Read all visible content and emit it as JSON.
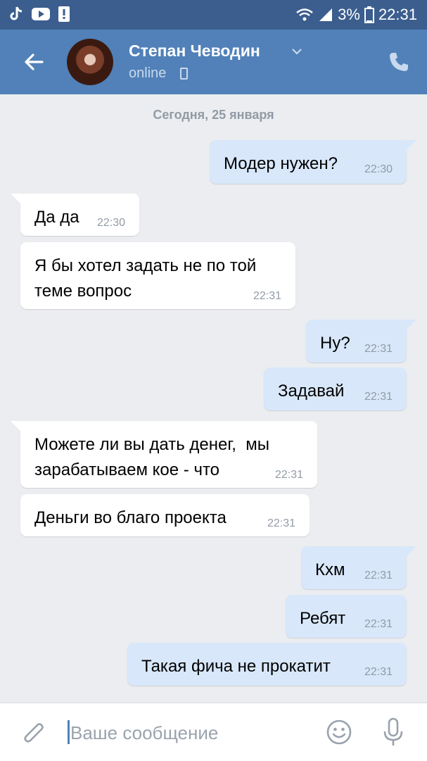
{
  "statusbar": {
    "battery_percent": "3%",
    "time": "22:31",
    "icons": [
      "tiktok-icon",
      "youtube-icon",
      "notification-icon",
      "wifi-icon",
      "signal-icon",
      "battery-icon"
    ]
  },
  "header": {
    "contact_name": "Степан Чеводин",
    "status": "online",
    "icons": [
      "back-arrow-icon",
      "avatar",
      "chevron-down-icon",
      "phone-icon",
      "mobile-status-icon"
    ]
  },
  "chat": {
    "date_divider": "Сегодня, 25 января",
    "messages": [
      {
        "dir": "out",
        "text": "Модер нужен?",
        "time": "22:30"
      },
      {
        "dir": "in",
        "text": "Да да",
        "time": "22:30"
      },
      {
        "dir": "in",
        "text": "Я бы хотел задать не по той\nтеме вопрос",
        "time": "22:31"
      },
      {
        "dir": "out",
        "text": "Ну?",
        "time": "22:31"
      },
      {
        "dir": "out",
        "text": "Задавай",
        "time": "22:31"
      },
      {
        "dir": "in",
        "text": "Можете ли вы дать денег,  мы\nзарабатываем кое - что",
        "time": "22:31"
      },
      {
        "dir": "in",
        "text": "Деньги во благо проекта",
        "time": "22:31"
      },
      {
        "dir": "out",
        "text": "Кхм",
        "time": "22:31"
      },
      {
        "dir": "out",
        "text": "Ребят",
        "time": "22:31"
      },
      {
        "dir": "out",
        "text": "Такая фича не прокатит",
        "time": "22:31"
      }
    ]
  },
  "composer": {
    "placeholder": "Ваше сообщение",
    "icons": [
      "attach-icon",
      "emoji-icon",
      "microphone-icon"
    ]
  },
  "colors": {
    "header_bg": "#5181b8",
    "statusbar_bg": "#3b5e8e",
    "chat_bg": "#ebedf0",
    "incoming_bubble": "#ffffff",
    "outgoing_bubble": "#d8e7fa",
    "accent": "#5181b8"
  }
}
